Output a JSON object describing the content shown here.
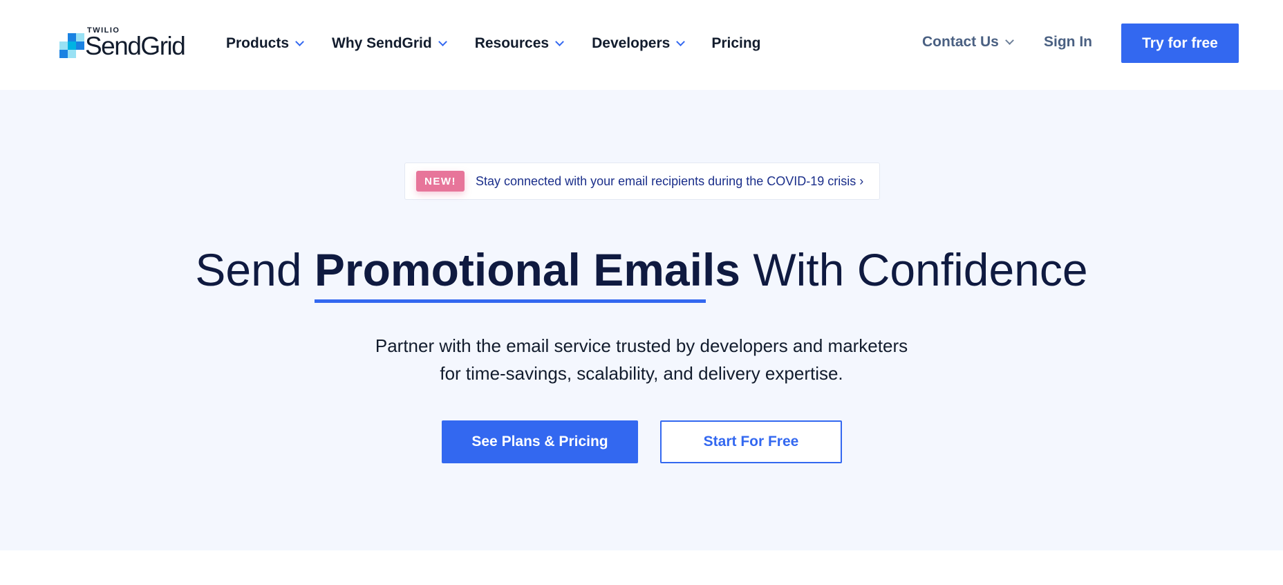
{
  "brand": {
    "parent": "TWILIO",
    "name": "SendGrid",
    "accent": "#3368f0",
    "dark": "#121c2d",
    "badge_color": "#e7759a",
    "hero_bg": "#f4f7fe"
  },
  "nav": {
    "items": [
      {
        "label": "Products",
        "has_dropdown": true
      },
      {
        "label": "Why SendGrid",
        "has_dropdown": true
      },
      {
        "label": "Resources",
        "has_dropdown": true
      },
      {
        "label": "Developers",
        "has_dropdown": true
      },
      {
        "label": "Pricing",
        "has_dropdown": false
      }
    ],
    "contact_label": "Contact Us",
    "signin_label": "Sign In",
    "try_label": "Try for free"
  },
  "announcement": {
    "badge": "NEW!",
    "text": "Stay connected with your email recipients during the COVID-19 crisis ›"
  },
  "hero": {
    "headline_pre": "Send ",
    "headline_bold": "Promotional Emails",
    "headline_post": " With Confidence",
    "subtext_line1": "Partner with the email service trusted by developers and marketers",
    "subtext_line2": "for time-savings, scalability, and delivery expertise.",
    "cta_primary": "See Plans & Pricing",
    "cta_secondary": "Start For Free"
  }
}
